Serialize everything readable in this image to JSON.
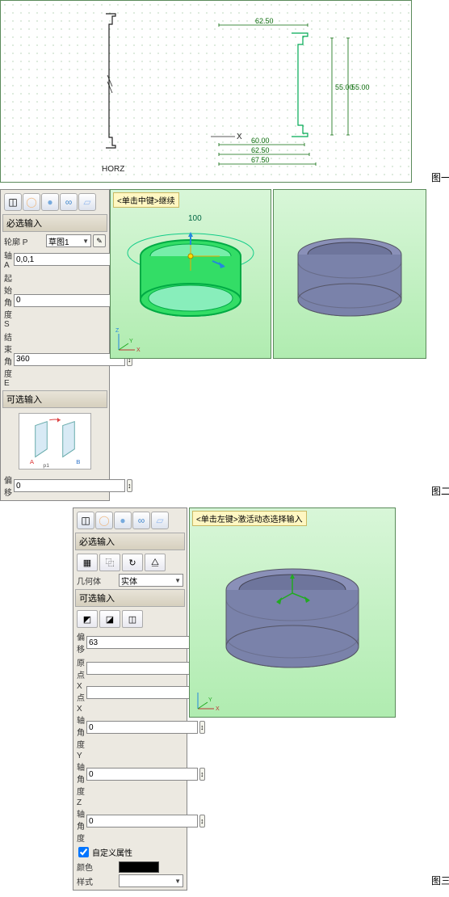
{
  "fig1": {
    "label": "图一",
    "axis_x": "X",
    "ref_label": "HORZ",
    "dims": {
      "d1": "62.50",
      "d2": "55.00",
      "d2b": "55.00",
      "d3": "60.00",
      "d4": "62.50",
      "d5": "67.50"
    }
  },
  "fig2": {
    "label": "图二",
    "hint": "<单击中键>继续",
    "dim_h": "100",
    "panel": {
      "section_required": "必选输入",
      "section_optional": "可选输入",
      "f_section": "轮廓 P",
      "f_section_val": "草图1",
      "f_axis": "轴 A",
      "f_axis_val": "0,0,1",
      "f_start": "起始角度 S",
      "f_start_val": "0",
      "f_end": "结束角度 E",
      "f_end_val": "360",
      "f_offset": "偏移",
      "f_offset_val": "0",
      "p_labels": {
        "a": "A",
        "b": "B",
        "p1": "p1"
      }
    }
  },
  "fig3": {
    "label": "图三",
    "hint": "<单击左键>激活动态选择输入",
    "panel": {
      "section_required": "必选输入",
      "section_optional": "可选输入",
      "f_geom": "几何体",
      "f_geom_val": "实体",
      "f_offset": "偏移",
      "f_offset_val": "63",
      "f_origin": "原点",
      "f_origin_val": "",
      "f_xpt": "X 点",
      "f_xpt_val": "",
      "f_xang": "X 轴角度",
      "f_xang_val": "0",
      "f_yang": "Y 轴角度",
      "f_yang_val": "0",
      "f_zang": "Z 轴角度",
      "f_zang_val": "0",
      "custom_attr": "自定义属性",
      "f_color": "颜色",
      "f_style": "样式"
    }
  }
}
